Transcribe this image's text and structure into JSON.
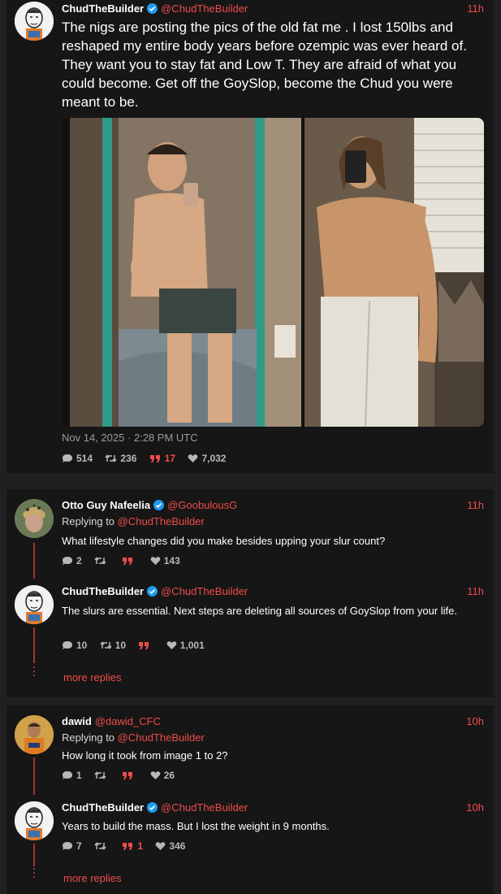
{
  "post": {
    "author": "ChudTheBuilder",
    "handle": "@ChudTheBuilder",
    "time": "11h",
    "text": "The nigs are posting the pics of the old fat me . I lost 150lbs and reshaped my entire body years before ozempic was ever heard of. They want you to stay fat and Low T. They are afraid of what you could become. Get off the GoySlop, become the Chud you were meant to be.",
    "timestamp": "Nov 14, 2025 · 2:28 PM UTC",
    "stats": {
      "replies": "514",
      "retweets": "236",
      "quotes": "17",
      "likes": "7,032"
    }
  },
  "thread1": {
    "reply": {
      "author": "Otto Guy Nafeelia",
      "handle": "@GoobulousG",
      "time": "11h",
      "replying_to_label": "Replying to",
      "replying_to": "@ChudTheBuilder",
      "text": "What lifestyle changes did you make besides upping your slur count?",
      "stats": {
        "replies": "2",
        "retweets": "",
        "quotes": "",
        "likes": "143"
      }
    },
    "response": {
      "author": "ChudTheBuilder",
      "handle": "@ChudTheBuilder",
      "time": "11h",
      "text": "The slurs are essential. Next steps are deleting all sources of GoySlop from your life.",
      "stats": {
        "replies": "10",
        "retweets": "10",
        "quotes": "",
        "likes": "1,001"
      }
    },
    "more_label": "more replies"
  },
  "thread2": {
    "reply": {
      "author": "dawid",
      "handle": "@dawid_CFC",
      "time": "10h",
      "replying_to_label": "Replying to",
      "replying_to": "@ChudTheBuilder",
      "text": "How long it took from image 1 to 2?",
      "stats": {
        "replies": "1",
        "retweets": "",
        "quotes": "",
        "likes": "26"
      }
    },
    "response": {
      "author": "ChudTheBuilder",
      "handle": "@ChudTheBuilder",
      "time": "10h",
      "text": "Years to build the mass. But I lost the weight in 9 months.",
      "stats": {
        "replies": "7",
        "retweets": "",
        "quotes": "1",
        "likes": "346"
      }
    },
    "more_label": "more replies"
  },
  "colors": {
    "accent": "#f04b4b",
    "verified": "#1d9bf0",
    "card": "#161616",
    "page": "#202020"
  }
}
